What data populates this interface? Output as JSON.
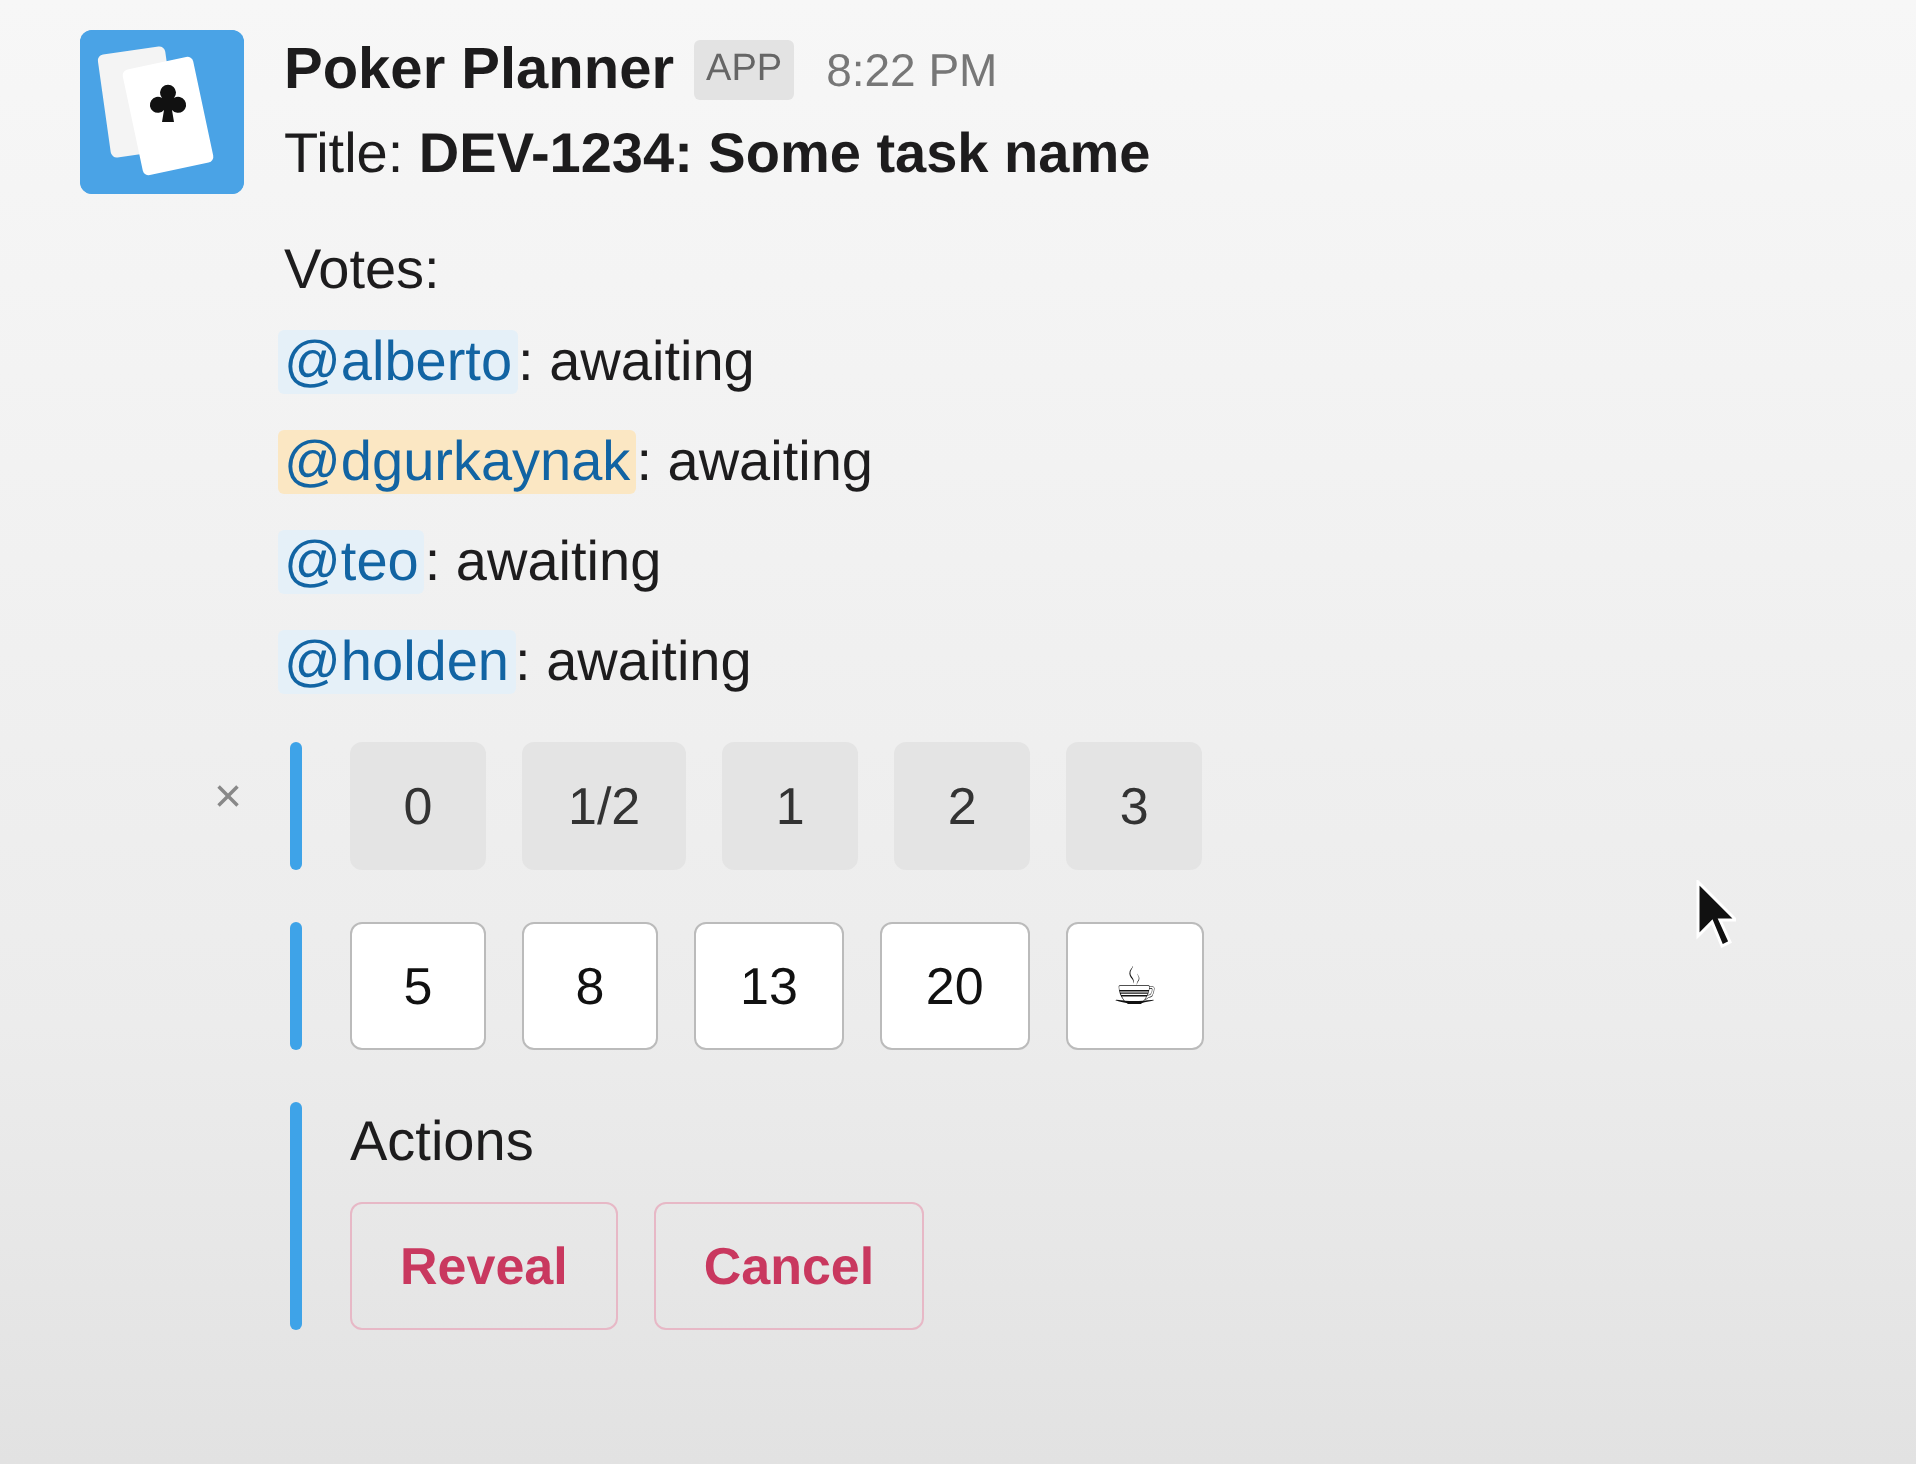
{
  "message": {
    "sender": "Poker Planner",
    "badge": "APP",
    "time": "8:22 PM",
    "title": "Title: **DEV-1234: Some task name**",
    "votes_heading": "Votes:",
    "votes": [
      {
        "mention": "@alberto",
        "highlighted": false,
        "status": ": awaiting"
      },
      {
        "mention": "@dgurkaynak",
        "highlighted": true,
        "status": ": awaiting"
      },
      {
        "mention": "@teo",
        "highlighted": false,
        "status": ": awaiting"
      },
      {
        "mention": "@holden",
        "highlighted": false,
        "status": ": awaiting"
      }
    ],
    "dismiss": "×",
    "button_rows": [
      {
        "kind": "filled",
        "buttons": [
          "0",
          "1/2",
          "1",
          "2",
          "3"
        ]
      },
      {
        "kind": "outlined",
        "buttons": [
          "5",
          "8",
          "13",
          "20",
          "☕"
        ]
      }
    ],
    "actions": {
      "heading": "Actions",
      "buttons": [
        "Reveal",
        "Cancel"
      ]
    }
  }
}
